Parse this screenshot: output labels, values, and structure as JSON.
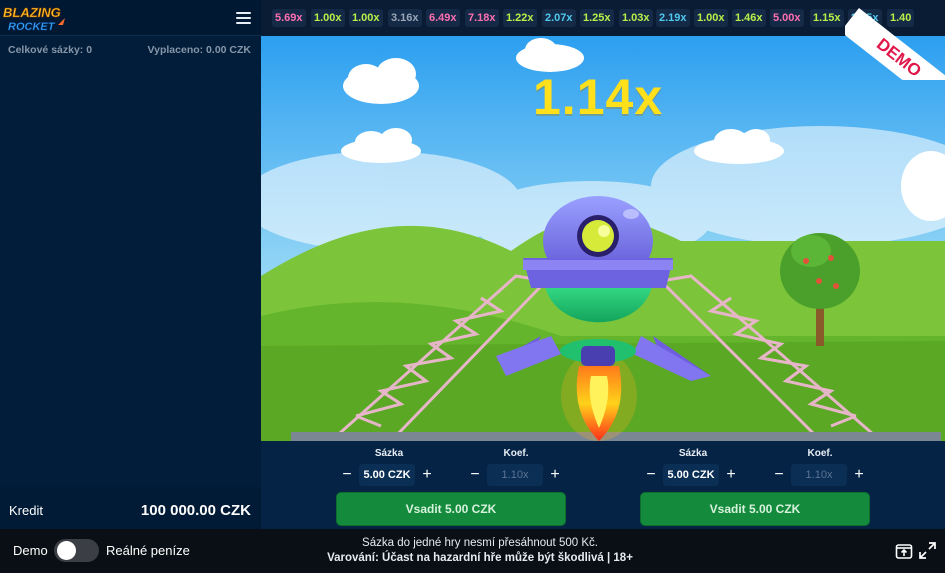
{
  "brand": {
    "logo_line1": "BLAZING",
    "logo_line2": "ROCKET"
  },
  "stats": {
    "total_bets": "Celkové sázky: 0",
    "paid_out": "Vyplaceno: 0.00 CZK"
  },
  "credit": {
    "label": "Kredit",
    "value": "100 000.00 CZK"
  },
  "history": [
    {
      "value": "5.69x",
      "color": "#ff6fb0"
    },
    {
      "value": "1.00x",
      "color": "#b8f04a"
    },
    {
      "value": "1.00x",
      "color": "#b8f04a"
    },
    {
      "value": "3.16x",
      "color": "#9aa6b6"
    },
    {
      "value": "6.49x",
      "color": "#ff6fb0"
    },
    {
      "value": "7.18x",
      "color": "#ff6fb0"
    },
    {
      "value": "1.22x",
      "color": "#b8f04a"
    },
    {
      "value": "2.07x",
      "color": "#4fc9f0"
    },
    {
      "value": "1.25x",
      "color": "#b8f04a"
    },
    {
      "value": "1.03x",
      "color": "#b8f04a"
    },
    {
      "value": "2.19x",
      "color": "#4fc9f0"
    },
    {
      "value": "1.00x",
      "color": "#b8f04a"
    },
    {
      "value": "1.46x",
      "color": "#b8f04a"
    },
    {
      "value": "5.00x",
      "color": "#ff6fb0"
    },
    {
      "value": "1.15x",
      "color": "#b8f04a"
    },
    {
      "value": "2.15x",
      "color": "#4fc9f0"
    },
    {
      "value": "1.40",
      "color": "#b8f04a"
    }
  ],
  "game": {
    "multiplier": "1.14x",
    "demo_ribbon": "DEMO"
  },
  "bets": [
    {
      "amount_label": "Sázka",
      "amount_value": "5.00 CZK",
      "minus": "−",
      "plus": "+",
      "coef_label": "Koef.",
      "coef_value": "1.10x",
      "button": "Vsadit 5.00 CZK"
    },
    {
      "amount_label": "Sázka",
      "amount_value": "5.00 CZK",
      "minus": "−",
      "plus": "+",
      "coef_label": "Koef.",
      "coef_value": "1.10x",
      "button": "Vsadit 5.00 CZK"
    }
  ],
  "bottom": {
    "demo_label": "Demo",
    "real_label": "Reálné peníze",
    "toggle_on": false,
    "notice": "Sázka do jedné hry nesmí přesáhnout 500 Kč.",
    "warning": "Varování: Účast na hazardní hře může být škodlivá | 18+"
  },
  "icons": {
    "menu": "hamburger-menu-icon",
    "rules": "rules-book-icon",
    "fullscreen": "fullscreen-expand-icon"
  }
}
